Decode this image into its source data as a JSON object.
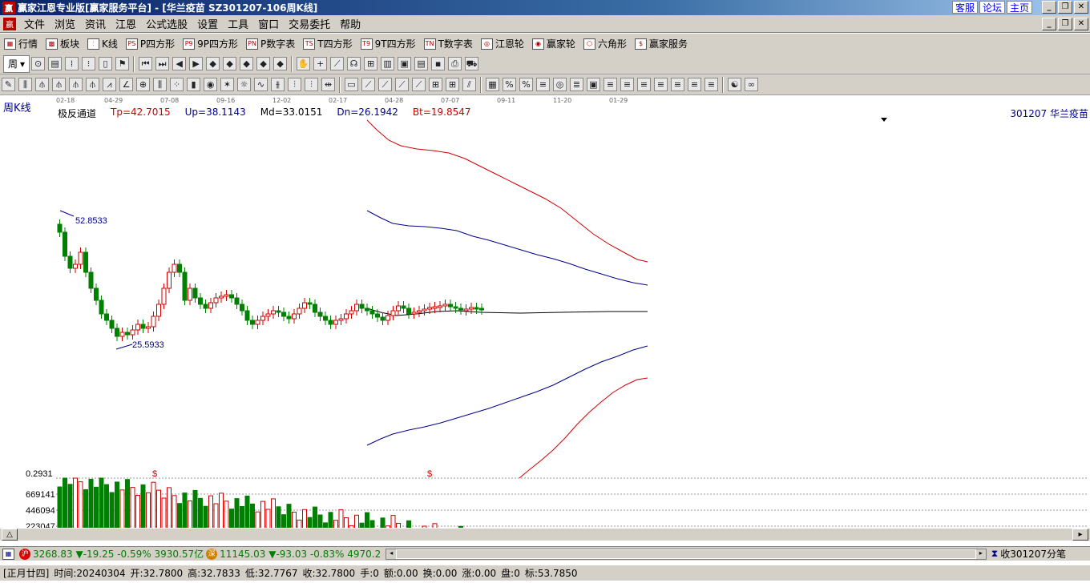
{
  "window": {
    "title": "赢家江恩专业版[赢家服务平台] - [华兰疫苗  SZ301207-106周K线]",
    "title_links": [
      "客服",
      "论坛",
      "主页"
    ]
  },
  "menu": [
    "文件",
    "浏览",
    "资讯",
    "江恩",
    "公式选股",
    "设置",
    "工具",
    "窗口",
    "交易委托",
    "帮助"
  ],
  "toolbar1": [
    "行情",
    "板块",
    "K线",
    "P四方形",
    "9P四方形",
    "P数字表",
    "T四方形",
    "9T四方形",
    "T数字表",
    "江恩轮",
    "赢家轮",
    "六角形",
    "赢家服务"
  ],
  "period_select": "周",
  "date_ticks": [
    "02-18",
    "04-29",
    "07-08",
    "09-16",
    "12-02",
    "02-17",
    "04-28",
    "07-07",
    "09-11",
    "11-20",
    "01-29"
  ],
  "chart_header": {
    "period_label": "周K线",
    "indicator_name": "极反通道",
    "tp": "Tp=42.7015",
    "up": "Up=38.1143",
    "md": "Md=33.0151",
    "dn": "Dn=26.1942",
    "bt": "Bt=19.8547",
    "stock": "301207 华兰疫苗"
  },
  "chart_data": {
    "type": "candlestick",
    "price_annotations": {
      "high": "52.8533",
      "low": "25.5933"
    },
    "channel_lines": [
      "Tp",
      "Up",
      "Md",
      "Dn",
      "Bt"
    ],
    "volume_axis_labels": [
      "0.2931",
      "669141",
      "446094",
      "223047"
    ],
    "markers": [
      "$",
      "$"
    ]
  },
  "status_bar": {
    "sh_value": "3268.83",
    "sh_change": "-19.25",
    "sh_pct": "-0.59%",
    "sh_amount": "3930.57亿",
    "sz_value": "11145.03",
    "sz_change": "-93.03",
    "sz_pct": "-0.83%",
    "sz_amount": "4970.2",
    "ticks_label": "收301207分笔",
    "sh_badge": "沪",
    "sz_badge": "深"
  },
  "info_bar": {
    "lunar": "[正月廿四]",
    "time": "时间:20240304",
    "open": "开:32.7800",
    "high": "高:32.7833",
    "low": "低:32.7767",
    "close": "收:32.7800",
    "hand": "手:0",
    "amount": "额:0.00",
    "turnover": "换:0.00",
    "rise": "涨:0.00",
    "board": "盘:0",
    "mark": "标:53.7850"
  }
}
